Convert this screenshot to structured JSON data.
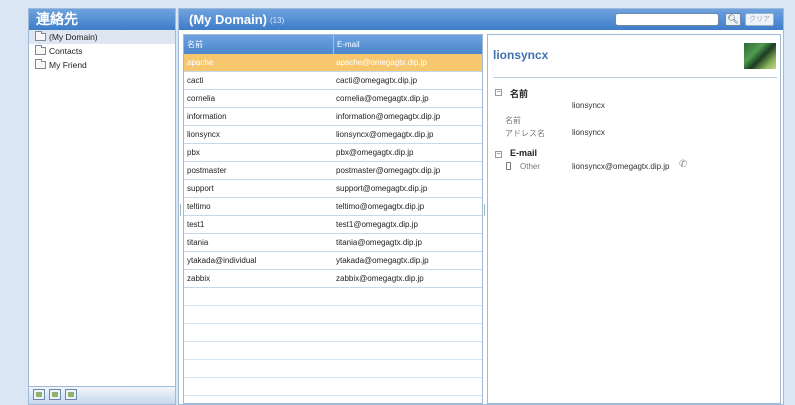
{
  "sidebar": {
    "title": "連絡先",
    "folders": [
      {
        "label": "(My Domain)"
      },
      {
        "label": "Contacts"
      },
      {
        "label": "My Friend"
      }
    ]
  },
  "header": {
    "title": "(My Domain)",
    "count": "(13)",
    "search": {
      "value": "",
      "placeholder": ""
    },
    "clear_label": "クリア"
  },
  "list": {
    "columns": {
      "name": "名前",
      "email": "E-mail"
    },
    "rows": [
      {
        "name": "apache",
        "email": "apache@omegagtx.dip.jp"
      },
      {
        "name": "cacti",
        "email": "cacti@omegagtx.dip.jp"
      },
      {
        "name": "cornelia",
        "email": "cornelia@omegagtx.dip.jp"
      },
      {
        "name": "information",
        "email": "information@omegagtx.dip.jp"
      },
      {
        "name": "lionsyncx",
        "email": "lionsyncx@omegagtx.dip.jp"
      },
      {
        "name": "pbx",
        "email": "pbx@omegagtx.dip.jp"
      },
      {
        "name": "postmaster",
        "email": "postmaster@omegagtx.dip.jp"
      },
      {
        "name": "support",
        "email": "support@omegagtx.dip.jp"
      },
      {
        "name": "teltimo",
        "email": "teltimo@omegagtx.dip.jp"
      },
      {
        "name": "test1",
        "email": "test1@omegagtx.dip.jp"
      },
      {
        "name": "titania",
        "email": "titania@omegagtx.dip.jp"
      },
      {
        "name": "ytakada@individual",
        "email": "ytakada@omegagtx.dip.jp"
      },
      {
        "name": "zabbix",
        "email": "zabbix@omegagtx.dip.jp"
      }
    ]
  },
  "detail": {
    "name": "lionsyncx",
    "name_section": {
      "title": "名前",
      "display_value": "lionsyncx",
      "name_label": "名前",
      "address_label": "アドレス名",
      "address_value": "lionsyncx"
    },
    "email_section": {
      "title": "E-mail",
      "type_label": "Other",
      "value": "lionsyncx@omegagtx.dip.jp"
    }
  },
  "colors": {
    "header": "#4d8ad4",
    "selected_row": "#f7c76e",
    "detail_name": "#3f72b0"
  }
}
